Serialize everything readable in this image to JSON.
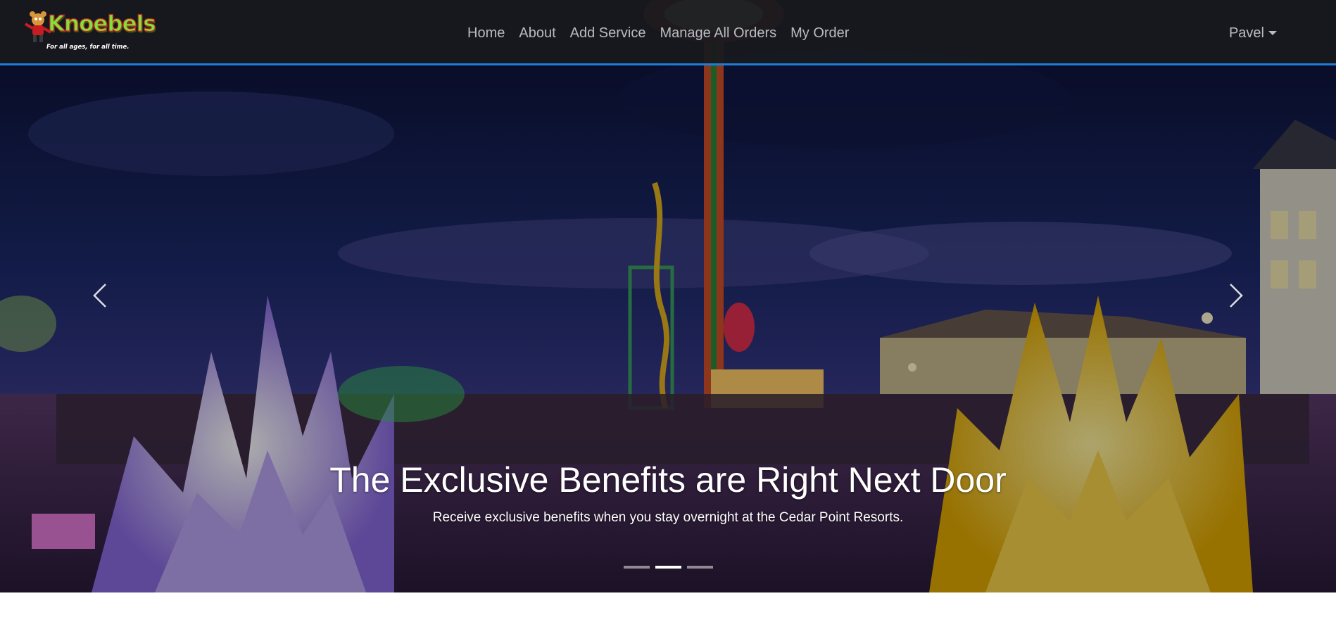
{
  "brand": {
    "name": "Knoebels",
    "tagline": "For all ages, for all time."
  },
  "nav": {
    "links": [
      {
        "label": "Home"
      },
      {
        "label": "About"
      },
      {
        "label": "Add Service"
      },
      {
        "label": "Manage All Orders"
      },
      {
        "label": "My Order"
      }
    ],
    "user": "Pavel"
  },
  "carousel": {
    "caption_title": "The Exclusive Benefits are Right Next Door",
    "caption_text": "Receive exclusive benefits when you stay overnight at the Cedar Point Resorts.",
    "slide_count": 3,
    "active_index": 1,
    "prev_icon": "chevron-left-icon",
    "next_icon": "chevron-right-icon"
  },
  "colors": {
    "navbar_bg": "#181a1e",
    "navbar_border": "#1e7ed6",
    "nav_text": "#b8bcc2",
    "brand_green": "#7ee23a",
    "brand_red": "#c51d22"
  }
}
